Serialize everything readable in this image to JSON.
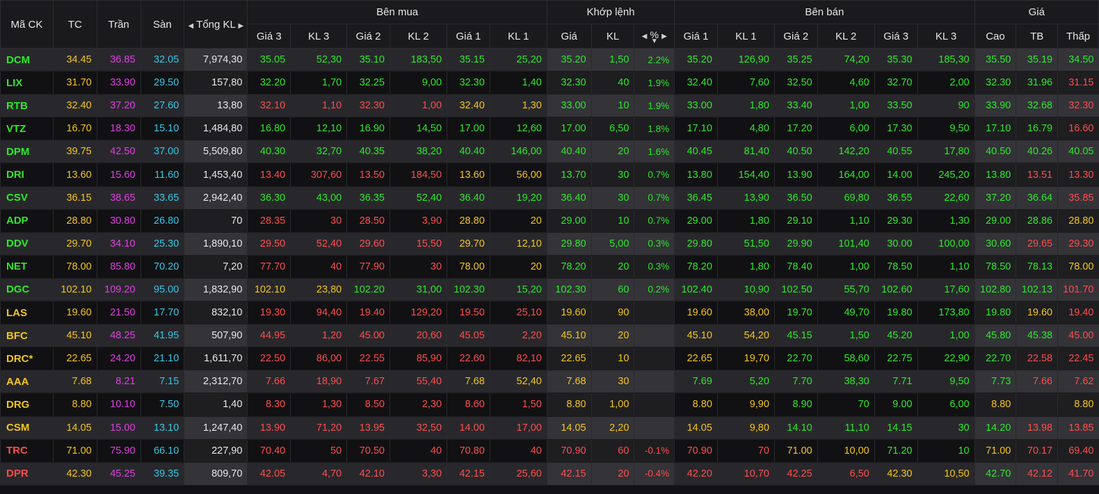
{
  "colors": {
    "green": "#2ee82b",
    "red": "#ff4d4d",
    "yellow": "#f5c518",
    "ceil": "#e23ee2",
    "floor": "#35c7e6",
    "white": "#e8e8e8"
  },
  "header": {
    "ma_ck": "Mã CK",
    "tc": "TC",
    "tran": "Trần",
    "san": "Sàn",
    "tong_kl": "Tổng KL",
    "ben_mua": "Bên mua",
    "khop_lenh": "Khớp lệnh",
    "ben_ban": "Bên bán",
    "gia": "Giá",
    "gia3": "Giá 3",
    "kl3": "KL 3",
    "gia2": "Giá 2",
    "kl2": "KL 2",
    "gia1": "Giá 1",
    "kl1": "KL 1",
    "m_gia": "Giá",
    "m_kl": "KL",
    "m_pct": "%",
    "s_gia1": "Giá 1",
    "s_kl1": "KL 1",
    "s_gia2": "Giá 2",
    "s_kl2": "KL 2",
    "s_gia3": "Giá 3",
    "s_kl3": "KL 3",
    "cao": "Cao",
    "tb": "TB",
    "thap": "Thấp"
  },
  "rows": [
    [
      "DCM",
      "34.45",
      "36.85",
      "32.05",
      "7,974,30",
      "35.05",
      "52,30",
      "35.10",
      "183,50",
      "35.15",
      "25,20",
      "35.20",
      "1,50",
      "2.2%",
      "35.20",
      "126,90",
      "35.25",
      "74,20",
      "35.30",
      "185,30",
      "35.50",
      "35.19",
      "34.50"
    ],
    [
      "LIX",
      "31.70",
      "33.90",
      "29.50",
      "157,80",
      "32.20",
      "1,70",
      "32.25",
      "9,00",
      "32.30",
      "1,40",
      "32.30",
      "40",
      "1.9%",
      "32.40",
      "7,60",
      "32.50",
      "4,60",
      "32.70",
      "2,00",
      "32.30",
      "31.96",
      "31.15"
    ],
    [
      "RTB",
      "32.40",
      "37.20",
      "27.60",
      "13,80",
      "32.10",
      "1,10",
      "32.30",
      "1,00",
      "32.40",
      "1,30",
      "33.00",
      "10",
      "1.9%",
      "33.00",
      "1,80",
      "33.40",
      "1,00",
      "33.50",
      "90",
      "33.90",
      "32.68",
      "32.30"
    ],
    [
      "VTZ",
      "16.70",
      "18.30",
      "15.10",
      "1,484,80",
      "16.80",
      "12,10",
      "16.90",
      "14,50",
      "17.00",
      "12,60",
      "17.00",
      "6,50",
      "1.8%",
      "17.10",
      "4,80",
      "17.20",
      "6,00",
      "17.30",
      "9,50",
      "17.10",
      "16.79",
      "16.60"
    ],
    [
      "DPM",
      "39.75",
      "42.50",
      "37.00",
      "5,509,80",
      "40.30",
      "32,70",
      "40.35",
      "38,20",
      "40.40",
      "146,00",
      "40.40",
      "20",
      "1.6%",
      "40.45",
      "81,40",
      "40.50",
      "142,20",
      "40.55",
      "17,80",
      "40.50",
      "40.26",
      "40.05"
    ],
    [
      "DRI",
      "13.60",
      "15.60",
      "11.60",
      "1,453,40",
      "13.40",
      "307,60",
      "13.50",
      "184,50",
      "13.60",
      "56,00",
      "13.70",
      "30",
      "0.7%",
      "13.80",
      "154,40",
      "13.90",
      "164,00",
      "14.00",
      "245,20",
      "13.80",
      "13.51",
      "13.30"
    ],
    [
      "CSV",
      "36.15",
      "38.65",
      "33.65",
      "2,942,40",
      "36.30",
      "43,00",
      "36.35",
      "52,40",
      "36.40",
      "19,20",
      "36.40",
      "30",
      "0.7%",
      "36.45",
      "13,90",
      "36.50",
      "69,80",
      "36.55",
      "22,60",
      "37.20",
      "36.64",
      "35.85"
    ],
    [
      "ADP",
      "28.80",
      "30.80",
      "26.80",
      "70",
      "28.35",
      "30",
      "28.50",
      "3,90",
      "28.80",
      "20",
      "29.00",
      "10",
      "0.7%",
      "29.00",
      "1,80",
      "29.10",
      "1,10",
      "29.30",
      "1,30",
      "29.00",
      "28.86",
      "28.80"
    ],
    [
      "DDV",
      "29.70",
      "34.10",
      "25.30",
      "1,890,10",
      "29.50",
      "52,40",
      "29.60",
      "15,50",
      "29.70",
      "12,10",
      "29.80",
      "5,00",
      "0.3%",
      "29.80",
      "51,50",
      "29.90",
      "101,40",
      "30.00",
      "100,00",
      "30.60",
      "29.65",
      "29.30"
    ],
    [
      "NET",
      "78.00",
      "85.80",
      "70.20",
      "7,20",
      "77.70",
      "40",
      "77.90",
      "30",
      "78.00",
      "20",
      "78.20",
      "20",
      "0.3%",
      "78.20",
      "1,80",
      "78.40",
      "1,00",
      "78.50",
      "1,10",
      "78.50",
      "78.13",
      "78.00"
    ],
    [
      "DGC",
      "102.10",
      "109.20",
      "95.00",
      "1,832,90",
      "102.10",
      "23,80",
      "102.20",
      "31,00",
      "102.30",
      "15,20",
      "102.30",
      "60",
      "0.2%",
      "102.40",
      "10,90",
      "102.50",
      "55,70",
      "102.60",
      "17,60",
      "102.80",
      "102.13",
      "101.70"
    ],
    [
      "LAS",
      "19.60",
      "21.50",
      "17.70",
      "832,10",
      "19.30",
      "94,40",
      "19.40",
      "129,20",
      "19.50",
      "25,10",
      "19.60",
      "90",
      "",
      "19.60",
      "38,00",
      "19.70",
      "49,70",
      "19.80",
      "173,80",
      "19.80",
      "19.60",
      "19.40"
    ],
    [
      "BFC",
      "45.10",
      "48.25",
      "41.95",
      "507,90",
      "44.95",
      "1,20",
      "45.00",
      "20,60",
      "45.05",
      "2,20",
      "45.10",
      "20",
      "",
      "45.10",
      "54,20",
      "45.15",
      "1,50",
      "45.20",
      "1,00",
      "45.80",
      "45.38",
      "45.00"
    ],
    [
      "DRC*",
      "22.65",
      "24.20",
      "21.10",
      "1,611,70",
      "22.50",
      "86,00",
      "22.55",
      "85,90",
      "22.60",
      "82,10",
      "22.65",
      "10",
      "",
      "22.65",
      "19,70",
      "22.70",
      "58,60",
      "22.75",
      "22,90",
      "22.70",
      "22.58",
      "22.45"
    ],
    [
      "AAA",
      "7.68",
      "8.21",
      "7.15",
      "2,312,70",
      "7.66",
      "18,90",
      "7.67",
      "55,40",
      "7.68",
      "52,40",
      "7.68",
      "30",
      "",
      "7.69",
      "5,20",
      "7.70",
      "38,30",
      "7.71",
      "9,50",
      "7.73",
      "7.66",
      "7.62"
    ],
    [
      "DRG",
      "8.80",
      "10.10",
      "7.50",
      "1,40",
      "8.30",
      "1,30",
      "8.50",
      "2,30",
      "8.60",
      "1,50",
      "8.80",
      "1,00",
      "",
      "8.80",
      "9,90",
      "8.90",
      "70",
      "9.00",
      "6,00",
      "8.80",
      "",
      "8.80"
    ],
    [
      "CSM",
      "14.05",
      "15.00",
      "13.10",
      "1,247,40",
      "13.90",
      "71,20",
      "13.95",
      "32,50",
      "14.00",
      "17,00",
      "14.05",
      "2,20",
      "",
      "14.05",
      "9,80",
      "14.10",
      "11,10",
      "14.15",
      "30",
      "14.20",
      "13.98",
      "13.85"
    ],
    [
      "TRC",
      "71.00",
      "75.90",
      "66.10",
      "227,90",
      "70.40",
      "50",
      "70.50",
      "40",
      "70.80",
      "40",
      "70.90",
      "60",
      "-0.1%",
      "70.90",
      "70",
      "71.00",
      "10,00",
      "71.20",
      "10",
      "71.00",
      "70.17",
      "69.40"
    ],
    [
      "DPR",
      "42.30",
      "45.25",
      "39.35",
      "809,70",
      "42.05",
      "4,70",
      "42.10",
      "3,30",
      "42.15",
      "25,60",
      "42.15",
      "20",
      "-0.4%",
      "42.20",
      "10,70",
      "42.25",
      "6,50",
      "42.30",
      "10,50",
      "42.70",
      "42.12",
      "41.70"
    ]
  ]
}
